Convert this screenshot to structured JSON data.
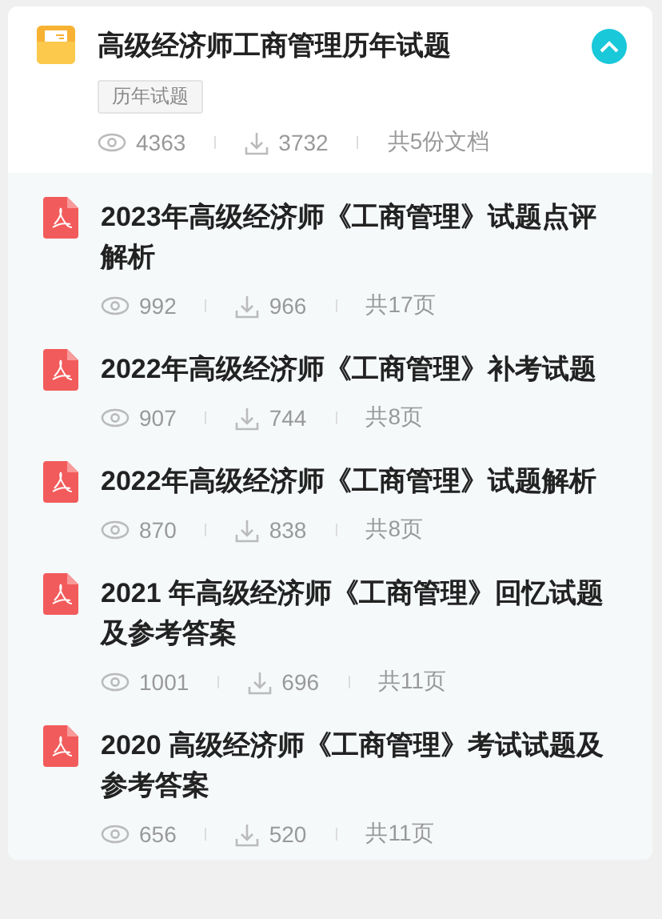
{
  "folder": {
    "title": "高级经济师工商管理历年试题",
    "tag": "历年试题",
    "views": "4363",
    "downloads": "3732",
    "count": "共5份文档",
    "expanded": true
  },
  "documents": [
    {
      "title": "2023年高级经济师《工商管理》试题点评解析",
      "views": "992",
      "downloads": "966",
      "pages": "共17页"
    },
    {
      "title": "2022年高级经济师《工商管理》补考试题",
      "views": "907",
      "downloads": "744",
      "pages": "共8页"
    },
    {
      "title": "2022年高级经济师《工商管理》试题解析",
      "views": "870",
      "downloads": "838",
      "pages": "共8页"
    },
    {
      "title": "2021 年高级经济师《工商管理》回忆试题及参考答案",
      "views": "1001",
      "downloads": "696",
      "pages": "共11页"
    },
    {
      "title": "2020 高级经济师《工商管理》考试试题及参考答案",
      "views": "656",
      "downloads": "520",
      "pages": "共11页"
    }
  ]
}
